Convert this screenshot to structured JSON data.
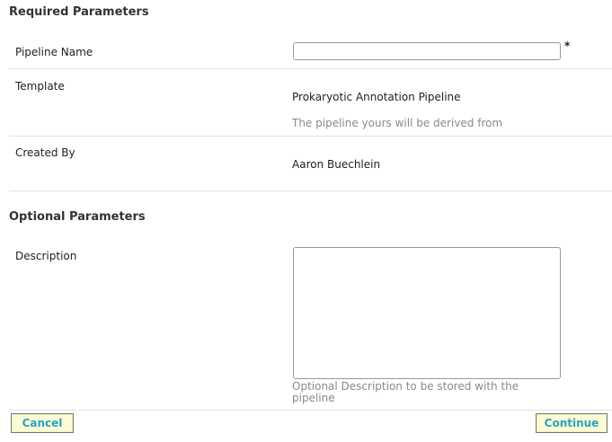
{
  "required_section": {
    "title": "Required Parameters",
    "pipeline_name": {
      "label": "Pipeline Name",
      "value": "",
      "required_marker": "*"
    },
    "template": {
      "label": "Template",
      "value": "Prokaryotic Annotation Pipeline",
      "hint": "The pipeline yours will be derived from"
    },
    "created_by": {
      "label": "Created By",
      "value": "Aaron Buechlein"
    }
  },
  "optional_section": {
    "title": "Optional Parameters",
    "description": {
      "label": "Description",
      "value": "",
      "hint": "Optional Description to be stored with the pipeline"
    }
  },
  "actions": {
    "cancel_label": "Cancel",
    "continue_label": "Continue"
  },
  "colors": {
    "button_bg": "#fbfbd4",
    "button_text": "#2aa3c2",
    "hint_text": "#8a8a8a"
  }
}
